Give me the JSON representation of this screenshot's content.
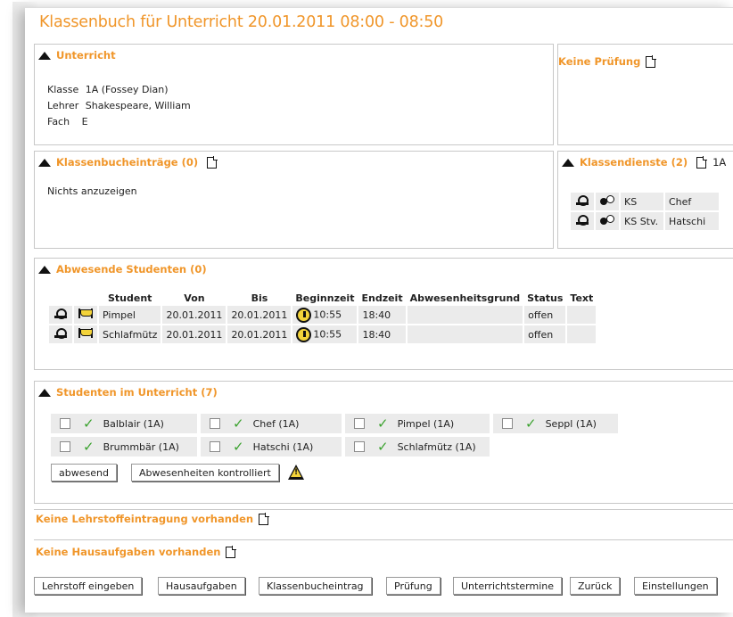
{
  "page_title": "Klassenbuch für Unterricht 20.01.2011 08:00 - 08:50",
  "unterricht": {
    "heading": "Unterricht",
    "rows": [
      {
        "key": "Klasse",
        "value": "1A (Fossey Dian)"
      },
      {
        "key": "Lehrer",
        "value": "Shakespeare, William"
      },
      {
        "key": "Fach",
        "value": "E"
      }
    ]
  },
  "pruefung": {
    "heading": "Keine Prüfung"
  },
  "klassenbucheintraege": {
    "heading": "Klassenbucheinträge (0)",
    "empty_text": "Nichts anzuzeigen"
  },
  "klassendienste": {
    "heading": "Klassendienste (2)",
    "heading_suffix": "1A",
    "rows": [
      {
        "code": "KS",
        "role": "Chef",
        "key_icon": "key-icon"
      },
      {
        "code": "KS Stv.",
        "role": "Hatschi",
        "key_icon": "key-2-icon"
      }
    ]
  },
  "abwesende": {
    "heading": "Abwesende Studenten (0)",
    "columns": [
      "Student",
      "Von",
      "Bis",
      "Beginnzeit",
      "Endzeit",
      "Abwesenheitsgrund",
      "Status",
      "Text"
    ],
    "rows": [
      {
        "student": "Pimpel",
        "von": "20.01.2011",
        "bis": "20.01.2011",
        "beginn": "10:55",
        "ende": "18:40",
        "grund": "",
        "status": "offen",
        "text": ""
      },
      {
        "student": "Schlafmütz",
        "von": "20.01.2011",
        "bis": "20.01.2011",
        "beginn": "10:55",
        "ende": "18:40",
        "grund": "",
        "status": "offen",
        "text": ""
      }
    ]
  },
  "studenten": {
    "heading": "Studenten im Unterricht (7)",
    "items": [
      {
        "name": "Balblair (1A)"
      },
      {
        "name": "Chef (1A)"
      },
      {
        "name": "Pimpel (1A)"
      },
      {
        "name": "Seppl (1A)"
      },
      {
        "name": "Brummbär (1A)"
      },
      {
        "name": "Hatschi (1A)"
      },
      {
        "name": "Schlafmütz (1A)"
      }
    ],
    "btn_abwesend": "abwesend",
    "btn_kontrolliert": "Abwesenheiten kontrolliert"
  },
  "lehrstoff": "Keine Lehrstoffeintragung vorhanden",
  "hausaufgaben": "Keine Hausaufgaben vorhanden",
  "footer_buttons": [
    "Lehrstoff eingeben",
    "Hausaufgaben",
    "Klassenbucheintrag",
    "Prüfung",
    "Unterrichtstermine",
    "Zurück",
    "Einstellungen"
  ],
  "colors": {
    "accent": "#f0962a",
    "cell_bg": "#ebebeb",
    "check": "#3aa22e",
    "warning": "#f3d33a"
  }
}
